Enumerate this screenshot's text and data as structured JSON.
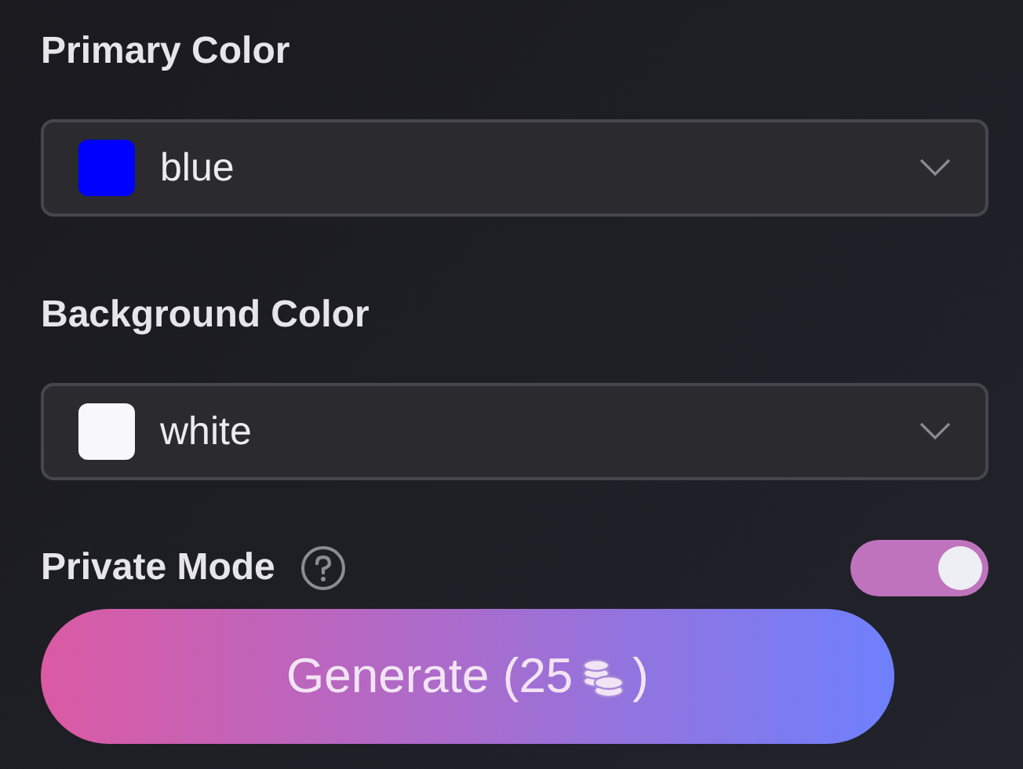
{
  "fields": [
    {
      "label": "Primary Color",
      "value": "blue",
      "color": "#0000ff"
    },
    {
      "label": "Background Color",
      "value": "white",
      "color": "#f8f8fc"
    }
  ],
  "private_mode": {
    "label": "Private Mode",
    "on": true
  },
  "generate_button": {
    "text_before": "Generate (25",
    "text_after": ")"
  }
}
